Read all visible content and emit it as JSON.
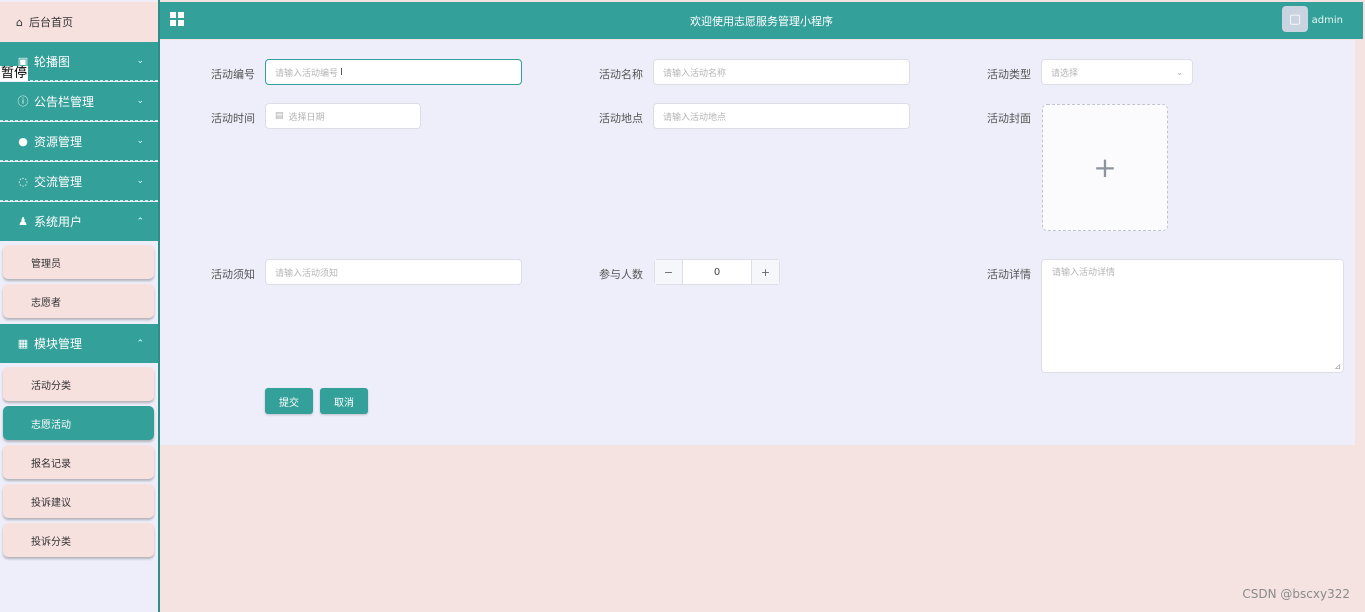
{
  "sidebar": {
    "home": {
      "label": "后台首页",
      "icon": "home-icon"
    },
    "menus": [
      {
        "label": "轮播图",
        "icon": "image-icon",
        "expanded": false
      },
      {
        "label": "公告栏管理",
        "icon": "info-icon",
        "expanded": false
      },
      {
        "label": "资源管理",
        "icon": "bulb-icon",
        "expanded": false
      },
      {
        "label": "交流管理",
        "icon": "chat-icon",
        "expanded": false
      },
      {
        "label": "系统用户",
        "icon": "user-icon",
        "expanded": true
      },
      {
        "label": "模块管理",
        "icon": "grid-icon",
        "expanded": true
      }
    ],
    "system_users_items": [
      "管理员",
      "志愿者"
    ],
    "module_items": [
      "活动分类",
      "志愿活动",
      "报名记录",
      "投诉建议",
      "投诉分类"
    ],
    "active_item": "志愿活动",
    "overlay_text": "暂停"
  },
  "header": {
    "title": "欢迎使用志愿服务管理小程序",
    "user": "admin"
  },
  "form": {
    "fields": {
      "activity_no": {
        "label": "活动编号",
        "placeholder": "请输入活动编号"
      },
      "activity_name": {
        "label": "活动名称",
        "placeholder": "请输入活动名称"
      },
      "activity_type": {
        "label": "活动类型",
        "placeholder": "请选择"
      },
      "activity_time": {
        "label": "活动时间",
        "placeholder": "选择日期"
      },
      "activity_place": {
        "label": "活动地点",
        "placeholder": "请输入活动地点"
      },
      "activity_cover": {
        "label": "活动封面"
      },
      "activity_notice": {
        "label": "活动须知",
        "placeholder": "请输入活动须知"
      },
      "participants": {
        "label": "参与人数",
        "value": "0"
      },
      "activity_detail": {
        "label": "活动详情",
        "placeholder": "请输入活动详情"
      }
    },
    "submit_label": "提交",
    "cancel_label": "取消"
  },
  "watermark": "CSDN @bscxy322",
  "colors": {
    "accent": "#34a09a",
    "sidebar_bg": "#eeeefa",
    "page_bg": "#f5e3e1"
  }
}
